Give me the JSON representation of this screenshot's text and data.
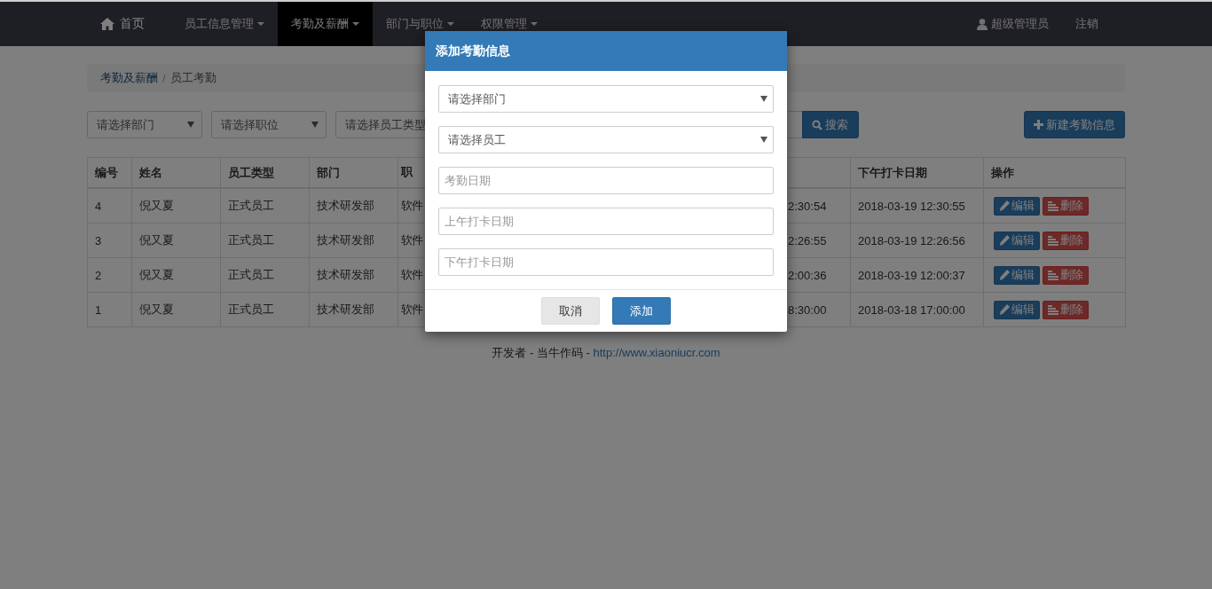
{
  "navbar": {
    "items": [
      {
        "kind": "home",
        "label": "首页",
        "dropdown": false,
        "selected": false
      },
      {
        "kind": "menu",
        "label": "员工信息管理",
        "dropdown": true,
        "selected": false
      },
      {
        "kind": "menu",
        "label": "考勤及薪酬",
        "dropdown": true,
        "selected": true
      },
      {
        "kind": "menu",
        "label": "部门与职位",
        "dropdown": true,
        "selected": false
      },
      {
        "kind": "menu",
        "label": "权限管理",
        "dropdown": true,
        "selected": false
      }
    ],
    "user": "超级管理员",
    "logout": "注销"
  },
  "breadcrumb": [
    {
      "label": "考勤及薪酬",
      "active": false
    },
    {
      "separator": "/"
    },
    {
      "label": "员工考勤",
      "active": true
    }
  ],
  "filters": {
    "selects": [
      "请选择部门",
      "请选择职位",
      "请选择员工类型"
    ],
    "search_button": "搜索",
    "new_button": "新建考勤信息"
  },
  "table": {
    "columns": [
      "编号",
      "姓名",
      "员工类型",
      "部门",
      "职",
      "",
      "下午打卡日期",
      "操作"
    ],
    "rows": [
      {
        "cells": [
          "4",
          "倪又夏",
          "正式员工",
          "技术研发部",
          "软件",
          "2:30:54",
          "2018-03-19 12:30:55"
        ],
        "actions": [
          "编辑",
          "删除"
        ]
      },
      {
        "cells": [
          "3",
          "倪又夏",
          "正式员工",
          "技术研发部",
          "软件",
          "2:26:55",
          "2018-03-19 12:26:56"
        ],
        "actions": [
          "编辑",
          "删除"
        ]
      },
      {
        "cells": [
          "2",
          "倪又夏",
          "正式员工",
          "技术研发部",
          "软件",
          "2:00:36",
          "2018-03-19 12:00:37"
        ],
        "actions": [
          "编辑",
          "删除"
        ]
      },
      {
        "cells": [
          "1",
          "倪又夏",
          "正式员工",
          "技术研发部",
          "软件",
          "8:30:00",
          "2018-03-18 17:00:00"
        ],
        "actions": [
          "编辑",
          "删除"
        ]
      }
    ]
  },
  "footer": {
    "text": "开发者 - 当牛作码 - ",
    "link": "http://www.xiaoniucr.com"
  },
  "modal": {
    "title": "添加考勤信息",
    "fields": [
      {
        "kind": "select",
        "placeholder": "请选择部门"
      },
      {
        "kind": "select",
        "placeholder": "请选择员工"
      },
      {
        "kind": "input",
        "placeholder": "考勤日期"
      },
      {
        "kind": "input",
        "placeholder": "上午打卡日期"
      },
      {
        "kind": "input",
        "placeholder": "下午打卡日期"
      }
    ],
    "buttons": [
      {
        "label": "取消",
        "primary": false
      },
      {
        "label": "添加",
        "primary": true
      }
    ]
  }
}
